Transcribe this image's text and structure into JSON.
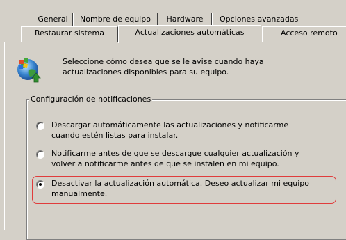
{
  "tabs_row_1": [
    {
      "label": "General"
    },
    {
      "label": "Nombre de equipo"
    },
    {
      "label": "Hardware"
    },
    {
      "label": "Opciones avanzadas"
    }
  ],
  "tabs_row_2": [
    {
      "label": "Restaurar sistema"
    },
    {
      "label": "Actualizaciones automáticas",
      "selected": true
    },
    {
      "label": "Acceso remoto"
    }
  ],
  "intro": {
    "icon": "windows-update-globe-icon",
    "text_line_1": "Seleccione cómo desea que se le avise cuando haya",
    "text_line_2": "actualizaciones disponibles para su equipo."
  },
  "notifications_group": {
    "title": "Configuración de notificaciones",
    "options": [
      {
        "line_1": "Descargar automáticamente las actualizaciones y notificarme",
        "line_2": "cuando estén listas para instalar.",
        "selected": false
      },
      {
        "line_1": "Notificarme antes de que se descargue cualquier actualización y",
        "line_2": "volver a notificarme antes de que se instalen en mi equipo.",
        "selected": false
      },
      {
        "line_1": "Desactivar la actualización automática. Deseo actualizar mi equipo",
        "line_2": "manualmente.",
        "selected": true
      }
    ]
  },
  "colors": {
    "window_face": "#d4d0c8",
    "highlight_outline": "#e03c3c"
  }
}
